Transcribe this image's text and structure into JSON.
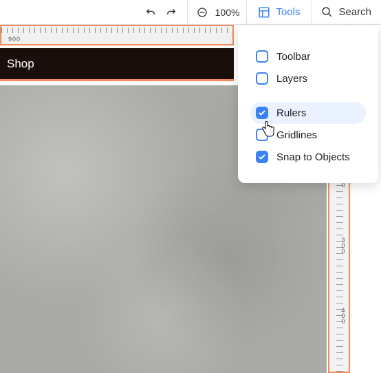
{
  "toolbar": {
    "zoom_label": "100%",
    "tools_label": "Tools",
    "search_label": "Search"
  },
  "ruler": {
    "h_tick": "900",
    "v_tick_top": "0",
    "v_tick_mid": "300",
    "v_tick_low": "400"
  },
  "page": {
    "nav_item": "Shop"
  },
  "tools_menu": {
    "items": [
      {
        "label": "Toolbar",
        "checked": false
      },
      {
        "label": "Layers",
        "checked": false
      },
      {
        "label": "Rulers",
        "checked": true,
        "highlighted": true
      },
      {
        "label": "Gridlines",
        "checked": false
      },
      {
        "label": "Snap to Objects",
        "checked": true
      }
    ]
  },
  "colors": {
    "accent": "#3b82f6",
    "highlight_border": "#f48a5a"
  }
}
